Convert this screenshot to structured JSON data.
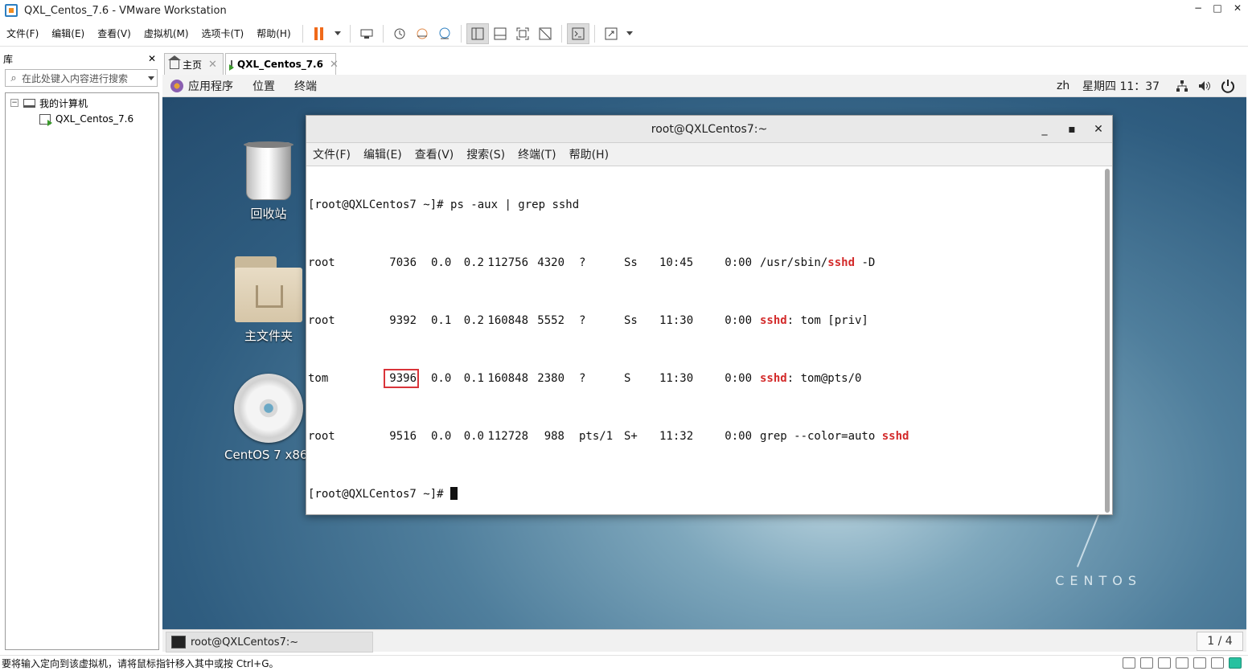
{
  "window": {
    "title": "QXL_Centos_7.6 - VMware Workstation",
    "controls": {
      "minimize": "−",
      "maximize": "□",
      "close": "✕"
    }
  },
  "menubar": {
    "items": [
      "文件(F)",
      "编辑(E)",
      "查看(V)",
      "虚拟机(M)",
      "选项卡(T)",
      "帮助(H)"
    ],
    "accent_color": "#f06a1a"
  },
  "library": {
    "title": "库",
    "close": "✕",
    "search_placeholder": "在此处键入内容进行搜索",
    "tree": {
      "root_label": "我的计算机",
      "root_toggle": "−",
      "vm_label": "QXL_Centos_7.6"
    }
  },
  "tabs": [
    {
      "label": "主页",
      "close": "✕"
    },
    {
      "label": "QXL_Centos_7.6",
      "close": "✕"
    }
  ],
  "gnome": {
    "menus": [
      "应用程序",
      "位置",
      "终端"
    ],
    "lang": "zh",
    "clock": "星期四 11：37"
  },
  "desktop": {
    "icons": [
      {
        "label": "回收站",
        "icon": "trash-icon"
      },
      {
        "label": "主文件夹",
        "icon": "home-folder-icon"
      },
      {
        "label": "CentOS 7 x86_6",
        "icon": "disc-icon"
      }
    ],
    "brand": "CENTOS"
  },
  "terminal": {
    "title": "root@QXLCentos7:~",
    "menus": [
      "文件(F)",
      "编辑(E)",
      "查看(V)",
      "搜索(S)",
      "终端(T)",
      "帮助(H)"
    ],
    "prompt": "[root@QXLCentos7 ~]# ",
    "command": "ps -aux | grep sshd",
    "highlight_color": "#d32a2a",
    "rows": [
      {
        "user": "root",
        "pid": "7036",
        "cpu": "0.0",
        "mem": "0.2",
        "vsz": "112756",
        "rss": "4320",
        "tty": "?",
        "stat": "Ss",
        "start": "10:45",
        "time": "0:00",
        "cmd_pre": "/usr/sbin/",
        "cmd_hl": "sshd",
        "cmd_post": " -D"
      },
      {
        "user": "root",
        "pid": "9392",
        "cpu": "0.1",
        "mem": "0.2",
        "vsz": "160848",
        "rss": "5552",
        "tty": "?",
        "stat": "Ss",
        "start": "11:30",
        "time": "0:00",
        "cmd_pre": "",
        "cmd_hl": "sshd",
        "cmd_post": ": tom [priv]"
      },
      {
        "user": "tom",
        "pid": "9396",
        "cpu": "0.0",
        "mem": "0.1",
        "vsz": "160848",
        "rss": "2380",
        "tty": "?",
        "stat": "S",
        "start": "11:30",
        "time": "0:00",
        "cmd_pre": "",
        "cmd_hl": "sshd",
        "cmd_post": ": tom@pts/0"
      },
      {
        "user": "root",
        "pid": "9516",
        "cpu": "0.0",
        "mem": "0.0",
        "vsz": "112728",
        "rss": "988",
        "tty": "pts/1",
        "stat": "S+",
        "start": "11:32",
        "time": "0:00",
        "cmd_pre": "grep --color=auto ",
        "cmd_hl": "sshd",
        "cmd_post": ""
      }
    ]
  },
  "vm_taskbar": {
    "task_label": "root@QXLCentos7:~",
    "workspace": "1 / 4"
  },
  "statusbar": {
    "message": "要将输入定向到该虚拟机，请将鼠标指针移入其中或按 Ctrl+G。"
  }
}
